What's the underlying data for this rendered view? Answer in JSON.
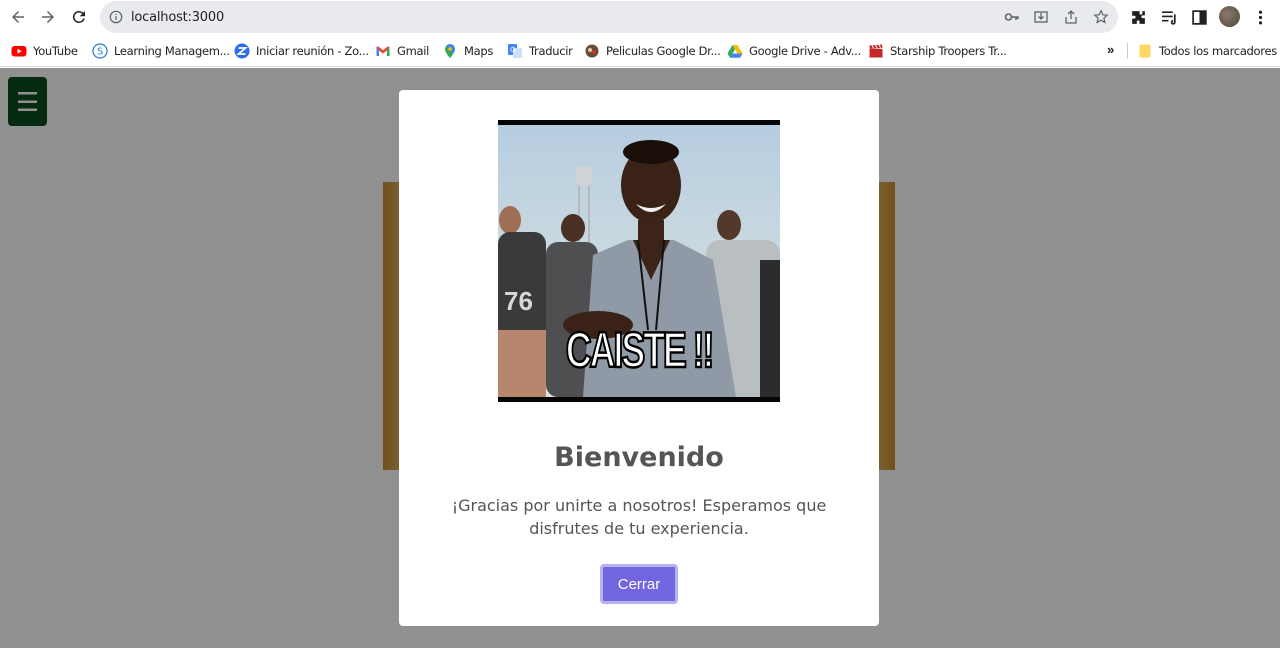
{
  "browser": {
    "url": "localhost:3000",
    "bookmarks": [
      {
        "label": "YouTube",
        "icon": "youtube-icon"
      },
      {
        "label": "Learning Managem...",
        "icon": "learning-management-icon"
      },
      {
        "label": "Iniciar reunión - Zo...",
        "icon": "zoom-icon"
      },
      {
        "label": "Gmail",
        "icon": "gmail-icon"
      },
      {
        "label": "Maps",
        "icon": "maps-pin-icon"
      },
      {
        "label": "Traducir",
        "icon": "translate-icon"
      },
      {
        "label": "Peliculas Google Dr...",
        "icon": "peliculas-icon"
      },
      {
        "label": "Google Drive - Adv...",
        "icon": "google-drive-icon"
      },
      {
        "label": "Starship Troopers Tr...",
        "icon": "clapperboard-icon"
      }
    ],
    "overflow": "»",
    "all_bookmarks": "Todos los marcadores"
  },
  "page": {
    "menu_icon": "☰"
  },
  "modal": {
    "gif_caption": "CAISTE !!",
    "title": "Bienvenido",
    "message": "¡Gracias por unirte a nosotros! Esperamos que disfrutes de tu experiencia.",
    "close_label": "Cerrar"
  },
  "colors": {
    "menu_button": "#0a4d1d",
    "close_button": "#7266e0",
    "overlay": "rgba(0,0,0,0.43)"
  }
}
